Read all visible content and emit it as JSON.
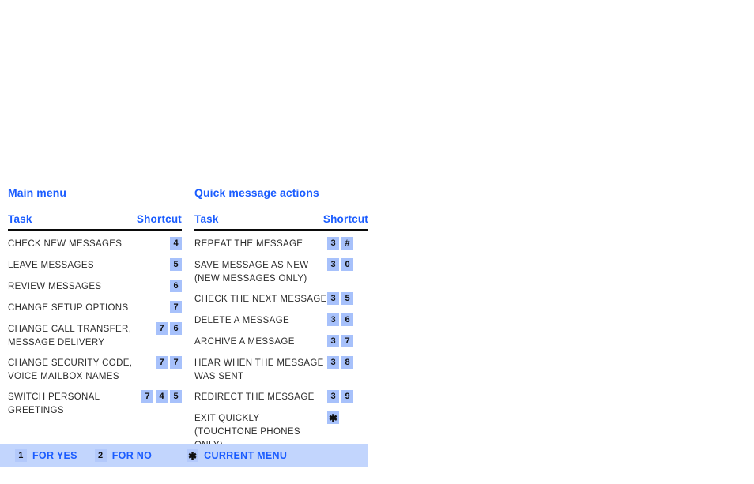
{
  "colors": {
    "accent_blue": "#1a5cff",
    "key_badge_bg": "#a7c1fb",
    "footer_bar_bg": "#c2d5fd",
    "footer_key_bg": "#b3c9fb",
    "task_text": "#2b2b2b",
    "rule": "#0a0a0a",
    "page_bg": "#ffffff"
  },
  "columns": [
    {
      "id": "main-menu",
      "title": "Main menu",
      "header": {
        "task": "Task",
        "shortcut": "Shortcut"
      },
      "rows": [
        {
          "task": "CHECK NEW MESSAGES",
          "task_line2": "",
          "keys": [
            "4"
          ]
        },
        {
          "task": "LEAVE MESSAGES",
          "task_line2": "",
          "keys": [
            "5"
          ]
        },
        {
          "task": "REVIEW MESSAGES",
          "task_line2": "",
          "keys": [
            "6"
          ]
        },
        {
          "task": "CHANGE SETUP OPTIONS",
          "task_line2": "",
          "keys": [
            "7"
          ]
        },
        {
          "task": "CHANGE CALL TRANSFER,",
          "task_line2": "MESSAGE DELIVERY",
          "keys": [
            "7",
            "6"
          ]
        },
        {
          "task": "CHANGE SECURITY CODE,",
          "task_line2": "VOICE MAILBOX NAMES",
          "keys": [
            "7",
            "7"
          ]
        },
        {
          "task": "SWITCH PERSONAL",
          "task_line2": "GREETINGS",
          "keys": [
            "7",
            "4",
            "5"
          ]
        }
      ]
    },
    {
      "id": "quick-message-actions",
      "title": "Quick message actions",
      "header": {
        "task": "Task",
        "shortcut": "Shortcut"
      },
      "rows": [
        {
          "task": "REPEAT THE MESSAGE",
          "task_line2": "",
          "keys": [
            "3",
            "#"
          ]
        },
        {
          "task": "SAVE MESSAGE AS NEW",
          "task_line2": "(NEW MESSAGES ONLY)",
          "keys": [
            "3",
            "0"
          ]
        },
        {
          "task": "CHECK THE NEXT MESSAGE",
          "task_line2": "",
          "keys": [
            "3",
            "5"
          ]
        },
        {
          "task": "DELETE A MESSAGE",
          "task_line2": "",
          "keys": [
            "3",
            "6"
          ]
        },
        {
          "task": "ARCHIVE A MESSAGE",
          "task_line2": "",
          "keys": [
            "3",
            "7"
          ]
        },
        {
          "task": "HEAR WHEN THE MESSAGE",
          "task_line2": "WAS SENT",
          "keys": [
            "3",
            "8"
          ]
        },
        {
          "task": "REDIRECT THE MESSAGE",
          "task_line2": "",
          "keys": [
            "3",
            "9"
          ]
        },
        {
          "task": "EXIT QUICKLY",
          "task_line2": "(TOUCHTONE PHONES ONLY)",
          "keys": [
            "✱"
          ]
        }
      ]
    }
  ],
  "footer": {
    "items": [
      {
        "id": "yes",
        "key": "1",
        "label": "FOR YES"
      },
      {
        "id": "no",
        "key": "2",
        "label": "FOR NO"
      },
      {
        "id": "current",
        "key": "✱",
        "label": "CURRENT MENU"
      }
    ]
  }
}
